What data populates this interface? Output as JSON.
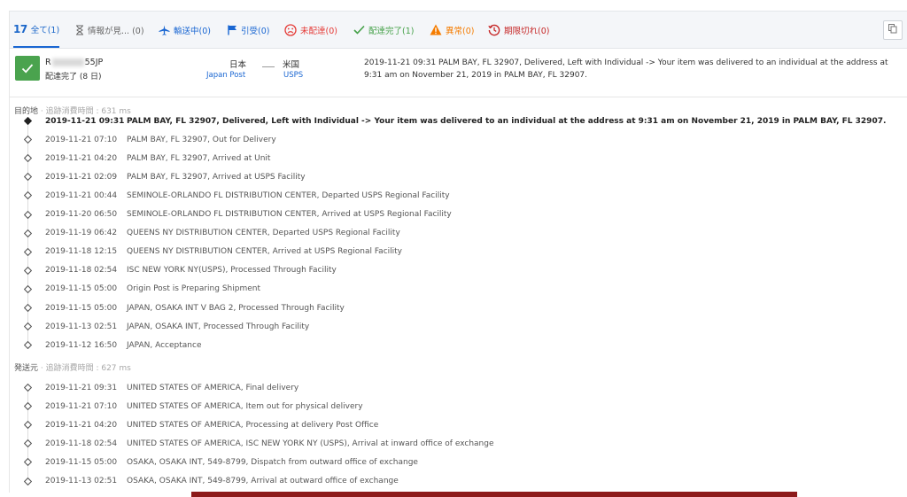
{
  "tabs": [
    {
      "brand": "17",
      "label": "全て(1)",
      "icon": "brand-17",
      "color": "#1a66c9",
      "active": true
    },
    {
      "label": "情報が見... (0)",
      "icon": "hourglass-icon",
      "color": "#666666"
    },
    {
      "label": "輸送中(0)",
      "icon": "airplane-icon",
      "color": "#1966d2"
    },
    {
      "label": "引受(0)",
      "icon": "flag-icon",
      "color": "#1966d2"
    },
    {
      "label": "未配達(0)",
      "icon": "sad-face-icon",
      "color": "#e53935"
    },
    {
      "label": "配達完了(1)",
      "icon": "check-icon",
      "color": "#43a047"
    },
    {
      "label": "異常(0)",
      "icon": "warning-icon",
      "color": "#f57c00"
    },
    {
      "label": "期限切れ(0)",
      "icon": "expired-clock-icon",
      "color": "#c62828"
    }
  ],
  "summary": {
    "tracking_prefix": "R",
    "tracking_suffix": "55JP",
    "status": "配達完了 (8 日)",
    "origin_country": "日本",
    "origin_carrier": "Japan Post",
    "dest_country": "米国",
    "dest_carrier": "USPS",
    "latest_event": "2019-11-21 09:31  PALM BAY, FL 32907, Delivered, Left with Individual -> Your item was delivered to an individual at the address at 9:31 am on November 21, 2019 in PALM BAY, FL 32907."
  },
  "destination": {
    "title": "目的地",
    "meta": " · 追跡消費時間 : 631 ms",
    "events": [
      {
        "time": "2019-11-21 09:31",
        "desc": "PALM BAY, FL 32907, Delivered, Left with Individual -> Your item was delivered to an individual at the address at 9:31 am on November 21, 2019 in PALM BAY, FL 32907."
      },
      {
        "time": "2019-11-21 07:10",
        "desc": "PALM BAY, FL 32907, Out for Delivery"
      },
      {
        "time": "2019-11-21 04:20",
        "desc": "PALM BAY, FL 32907, Arrived at Unit"
      },
      {
        "time": "2019-11-21 02:09",
        "desc": "PALM BAY, FL 32907, Arrived at USPS Facility"
      },
      {
        "time": "2019-11-21 00:44",
        "desc": "SEMINOLE-ORLANDO FL DISTRIBUTION CENTER, Departed USPS Regional Facility"
      },
      {
        "time": "2019-11-20 06:50",
        "desc": "SEMINOLE-ORLANDO FL DISTRIBUTION CENTER, Arrived at USPS Regional Facility"
      },
      {
        "time": "2019-11-19 06:42",
        "desc": "QUEENS NY DISTRIBUTION CENTER, Departed USPS Regional Facility"
      },
      {
        "time": "2019-11-18 12:15",
        "desc": "QUEENS NY DISTRIBUTION CENTER, Arrived at USPS Regional Facility"
      },
      {
        "time": "2019-11-18 02:54",
        "desc": "ISC NEW YORK NY(USPS), Processed Through Facility"
      },
      {
        "time": "2019-11-15 05:00",
        "desc": "Origin Post is Preparing Shipment"
      },
      {
        "time": "2019-11-15 05:00",
        "desc": "JAPAN, OSAKA INT V BAG 2, Processed Through Facility"
      },
      {
        "time": "2019-11-13 02:51",
        "desc": "JAPAN, OSAKA INT, Processed Through Facility"
      },
      {
        "time": "2019-11-12 16:50",
        "desc": "JAPAN, Acceptance"
      }
    ]
  },
  "origin": {
    "title": "発送元",
    "meta": " · 追跡消費時間 : 627 ms",
    "events": [
      {
        "time": "2019-11-21 09:31",
        "desc": "UNITED STATES OF AMERICA, Final delivery"
      },
      {
        "time": "2019-11-21 07:10",
        "desc": "UNITED STATES OF AMERICA, Item out for physical delivery"
      },
      {
        "time": "2019-11-21 04:20",
        "desc": "UNITED STATES OF AMERICA, Processing at delivery Post Office"
      },
      {
        "time": "2019-11-18 02:54",
        "desc": "UNITED STATES OF AMERICA, ISC NEW YORK NY (USPS), Arrival at inward office of exchange"
      },
      {
        "time": "2019-11-15 05:00",
        "desc": "OSAKA, OSAKA INT, 549-8799, Dispatch from outward office of exchange"
      },
      {
        "time": "2019-11-13 02:51",
        "desc": "OSAKA, OSAKA INT, 549-8799, Arrival at outward office of exchange"
      }
    ]
  }
}
